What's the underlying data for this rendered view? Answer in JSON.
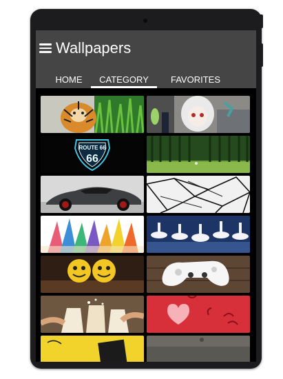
{
  "app": {
    "title": "Wallpapers"
  },
  "tabs": [
    {
      "label": "HOME"
    },
    {
      "label": "CATEGORY"
    },
    {
      "label": "FAVORITES"
    }
  ],
  "active_tab": "CATEGORY",
  "icons": {
    "menu": "hamburger-menu-icon"
  },
  "colors": {
    "appbar": "#454545",
    "background": "#000000",
    "tab_indicator": "#ffffff"
  },
  "categories": [
    {
      "name": "tiger"
    },
    {
      "name": "anime"
    },
    {
      "name": "route-66",
      "caption": "ROUTE 66"
    },
    {
      "name": "forest"
    },
    {
      "name": "car"
    },
    {
      "name": "abstract"
    },
    {
      "name": "pencils"
    },
    {
      "name": "ballet"
    },
    {
      "name": "smileys"
    },
    {
      "name": "controller"
    },
    {
      "name": "drinks"
    },
    {
      "name": "hearts"
    },
    {
      "name": "yellow"
    },
    {
      "name": "gray"
    }
  ]
}
